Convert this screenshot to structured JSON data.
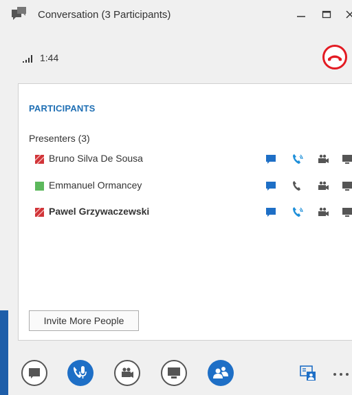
{
  "window": {
    "title": "Conversation (3 Participants)"
  },
  "call": {
    "elapsed": "1:44"
  },
  "participants_panel": {
    "heading": "PARTICIPANTS",
    "group_label": "Presenters (3)",
    "participants": [
      {
        "name": "Bruno Silva De Sousa",
        "status": "busy",
        "status_color": "#d13438",
        "bold": false,
        "call_color": "#1e8fd9"
      },
      {
        "name": "Emmanuel Ormancey",
        "status": "available",
        "status_color": "#5cb85c",
        "bold": false,
        "call_color": "#555555"
      },
      {
        "name": "Pawel Grzywaczewski",
        "status": "busy",
        "status_color": "#d13438",
        "bold": true,
        "call_color": "#1e8fd9"
      }
    ],
    "invite_label": "Invite More People"
  },
  "colors": {
    "accent": "#1e6fc6",
    "hangup": "#e31b23",
    "heading": "#1f6fb4"
  },
  "toolbar": {
    "buttons": [
      "chat-icon",
      "microphone-icon",
      "video-icon",
      "present-icon",
      "people-icon"
    ],
    "more_label": "..."
  }
}
